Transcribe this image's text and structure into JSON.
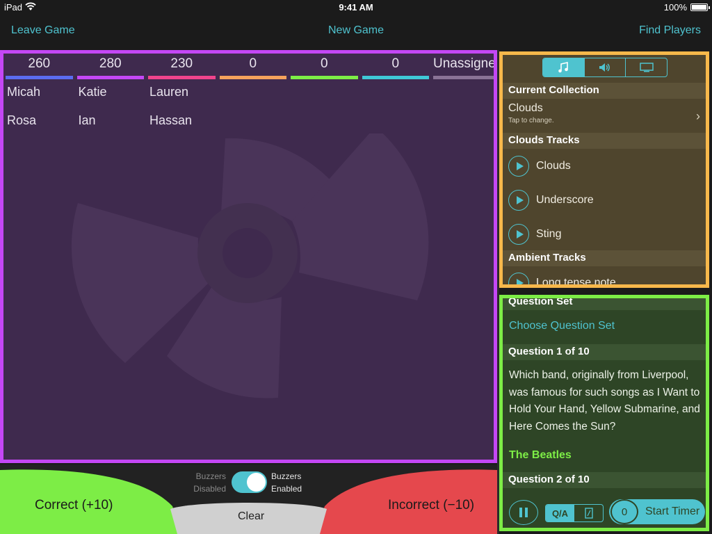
{
  "status_bar": {
    "device": "iPad",
    "time": "9:41 AM",
    "battery": "100%"
  },
  "nav": {
    "left": "Leave Game",
    "center": "New Game",
    "right": "Find Players"
  },
  "teams": [
    {
      "score": "260",
      "color": "#5b6cf0",
      "players": [
        "Micah",
        "Rosa"
      ]
    },
    {
      "score": "280",
      "color": "#c447f5",
      "players": [
        "Katie",
        "Ian"
      ]
    },
    {
      "score": "230",
      "color": "#f0448c",
      "players": [
        "Lauren",
        "Hassan"
      ]
    },
    {
      "score": "0",
      "color": "#f5a35c",
      "players": []
    },
    {
      "score": "0",
      "color": "#7ded46",
      "players": []
    },
    {
      "score": "0",
      "color": "#3fc9d6",
      "players": []
    },
    {
      "score": "Unassigned",
      "color": "#8a7396",
      "players": []
    }
  ],
  "music": {
    "tabs": [
      "music-note-icon",
      "speaker-icon",
      "display-icon"
    ],
    "current_collection_header": "Current Collection",
    "collection_name": "Clouds",
    "collection_hint": "Tap to change.",
    "tracks_header": "Clouds Tracks",
    "tracks": [
      "Clouds",
      "Underscore",
      "Sting"
    ],
    "ambient_header": "Ambient Tracks",
    "ambient_tracks": [
      "Long tense note"
    ]
  },
  "questions": {
    "set_header": "Question Set",
    "choose_set": "Choose Question Set",
    "q1_header": "Question 1 of 10",
    "q1_text": "Which band, originally from Liverpool, was famous for such songs as I Want to Hold Your Hand, Yellow Submarine, and Here Comes the Sun?",
    "q1_answer": "The Beatles",
    "q2_header": "Question 2 of 10",
    "qa_label": "Q/A",
    "timer_value": "0",
    "timer_label": "Start Timer"
  },
  "scoring": {
    "correct": "Correct (+10)",
    "incorrect": "Incorrect (−10)",
    "clear": "Clear",
    "buzzers_disabled": "Buzzers Disabled",
    "buzzers_enabled": "Buzzers Enabled",
    "buzzers_on": true,
    "correct_color": "#7ded46",
    "incorrect_color": "#e5484d"
  }
}
